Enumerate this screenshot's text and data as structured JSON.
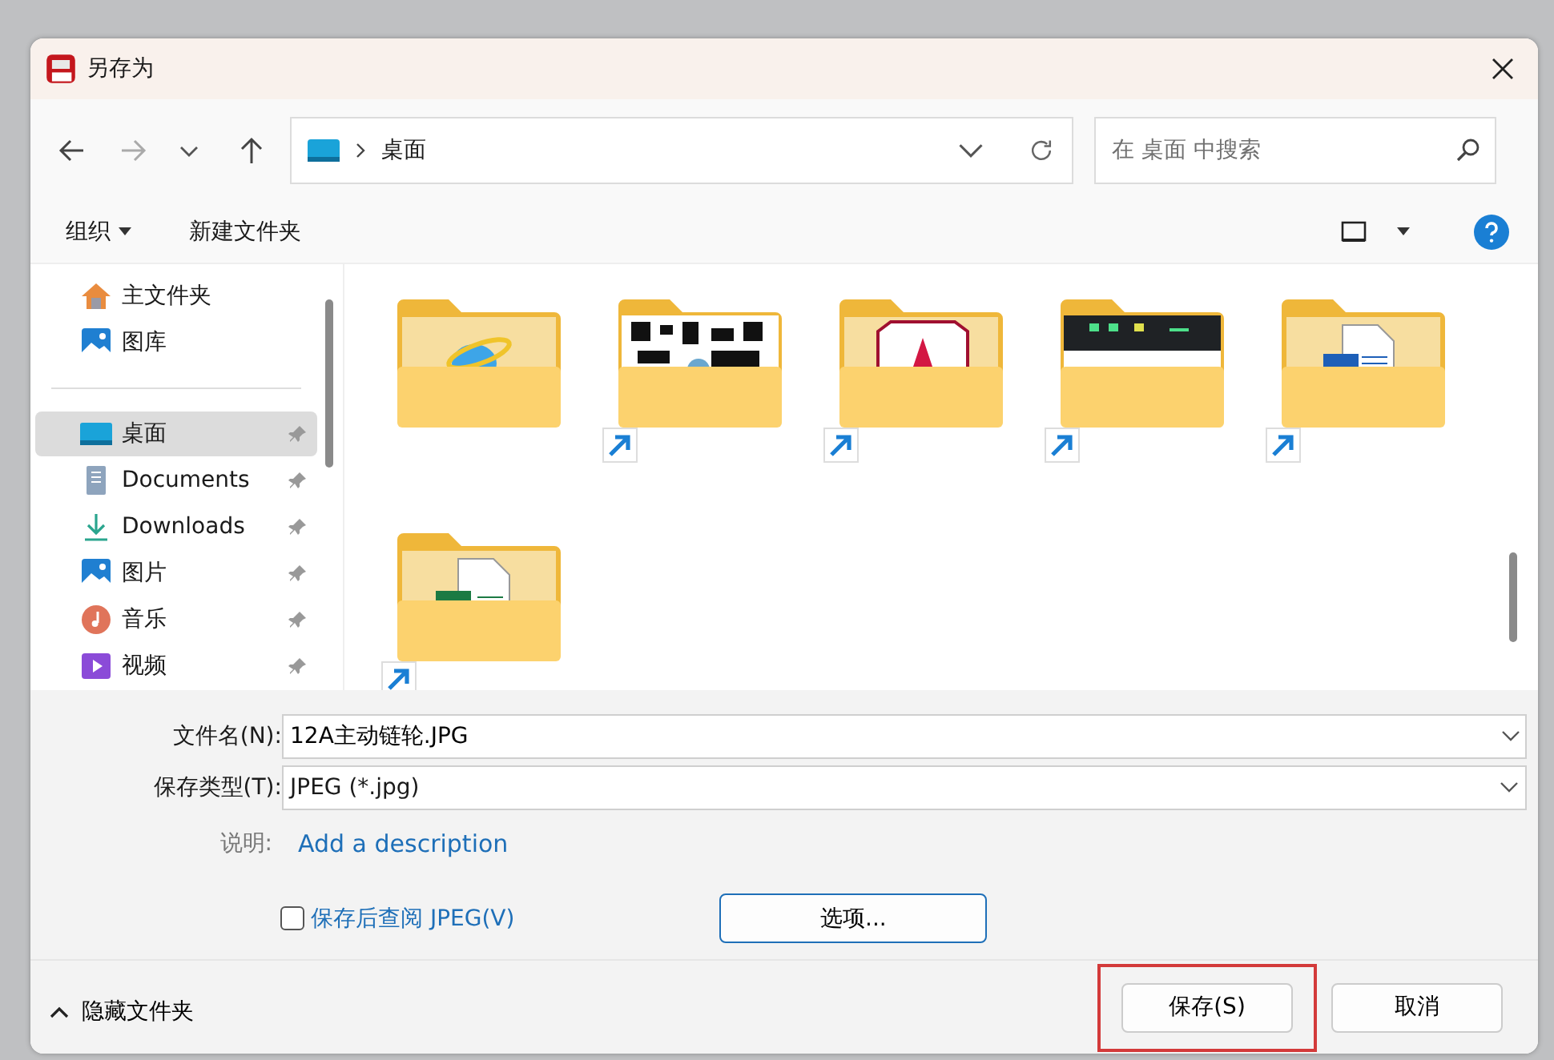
{
  "window": {
    "title": "另存为"
  },
  "address": {
    "path": "桌面"
  },
  "search": {
    "placeholder": "在 桌面 中搜索"
  },
  "toolbar": {
    "organize": "组织",
    "new_folder": "新建文件夹"
  },
  "sidebar": {
    "groups": [
      [
        {
          "label": "主文件夹",
          "kind": "home",
          "selected": false,
          "pinned": false
        },
        {
          "label": "图库",
          "kind": "gallery",
          "selected": false,
          "pinned": false
        }
      ],
      [
        {
          "label": "桌面",
          "kind": "desktop",
          "selected": true,
          "pinned": true
        },
        {
          "label": "Documents",
          "kind": "documents",
          "selected": false,
          "pinned": true
        },
        {
          "label": "Downloads",
          "kind": "downloads",
          "selected": false,
          "pinned": true
        },
        {
          "label": "图片",
          "kind": "pictures",
          "selected": false,
          "pinned": true
        },
        {
          "label": "音乐",
          "kind": "music",
          "selected": false,
          "pinned": true
        },
        {
          "label": "视频",
          "kind": "videos",
          "selected": false,
          "pinned": true
        }
      ]
    ]
  },
  "files": [
    {
      "kind": "browser",
      "shortcut": false
    },
    {
      "kind": "qr",
      "shortcut": true
    },
    {
      "kind": "app",
      "shortcut": true
    },
    {
      "kind": "screen",
      "shortcut": true
    },
    {
      "kind": "word",
      "shortcut": true
    },
    {
      "kind": "excel",
      "shortcut": true
    }
  ],
  "form": {
    "file_name_label": "文件名(N):",
    "file_name": "12A主动链轮.JPG",
    "type_label": "保存类型(T):",
    "type": "JPEG (*.jpg)",
    "description_label": "说明:",
    "description_link": "Add a description",
    "view_after_save": {
      "label": "保存后查阅 JPEG(V)",
      "checked": false
    },
    "options_button": "选项..."
  },
  "footer": {
    "hide_folders": "隐藏文件夹",
    "save_button": {
      "label": "保存(S)",
      "highlighted": true
    },
    "cancel_button": "取消"
  }
}
